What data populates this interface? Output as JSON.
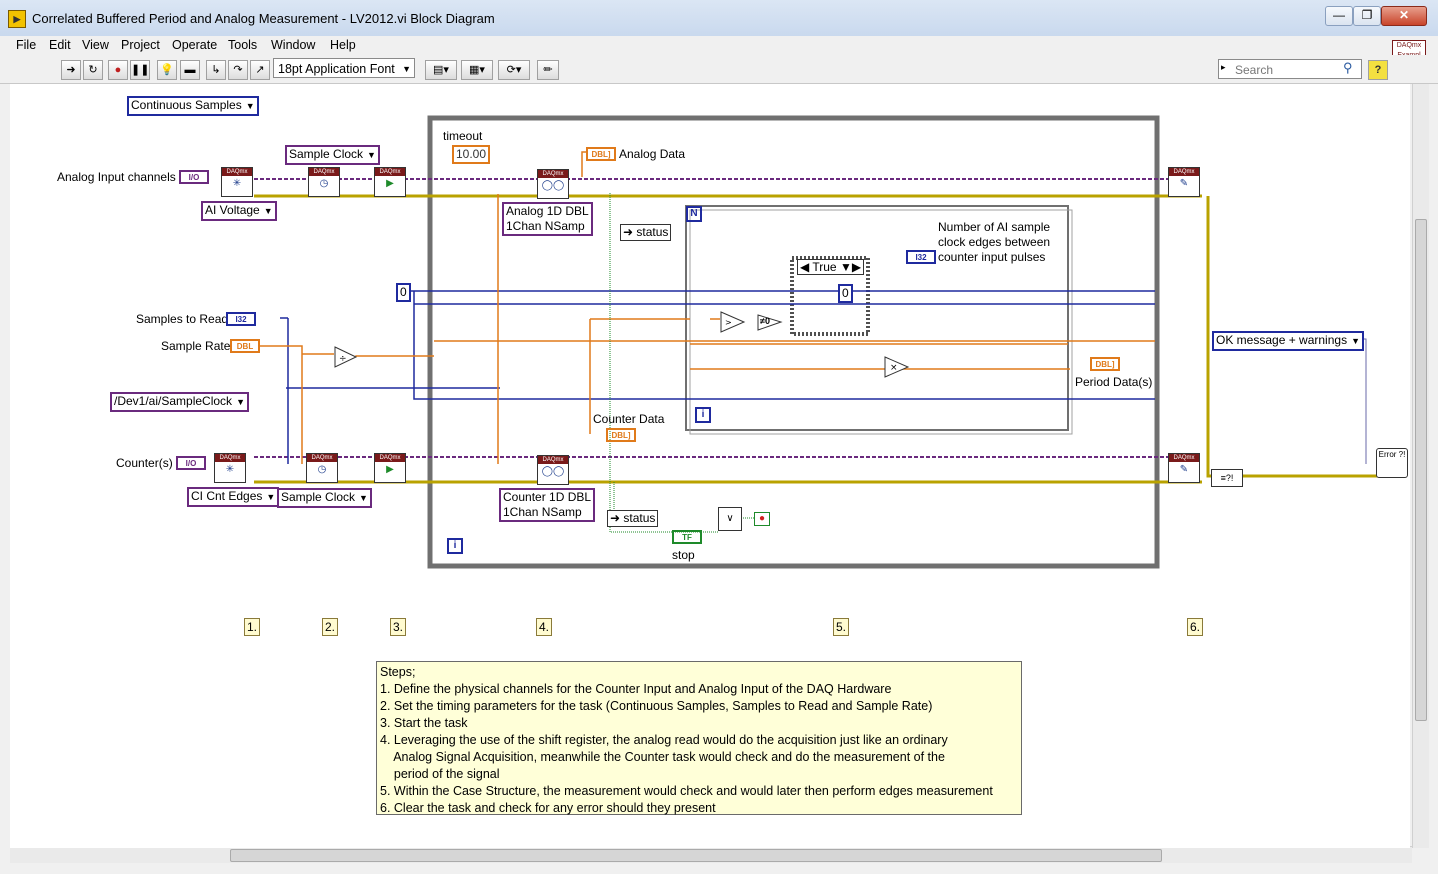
{
  "window": {
    "title": "Correlated Buffered Period and Analog Measurement - LV2012.vi Block Diagram",
    "controls": [
      "—",
      "❐",
      "✕"
    ]
  },
  "menu": [
    "File",
    "Edit",
    "View",
    "Project",
    "Operate",
    "Tools",
    "Window",
    "Help"
  ],
  "toolbar": {
    "font": "18pt Application Font",
    "search_placeholder": "Search",
    "help": "?",
    "example_badge": "DAQmx Exampl"
  },
  "labels": {
    "analog_input_channels": "Analog Input channels",
    "samples_to_read": "Samples to Read",
    "sample_rate": "Sample Rate",
    "counters": "Counter(s)",
    "timeout": "timeout",
    "analog_data": "Analog Data",
    "counter_data": "Counter Data",
    "period_data": "Period Data(s)",
    "stop": "stop",
    "num_ai_edges_1": "Number of AI sample",
    "num_ai_edges_2": "clock edges between",
    "num_ai_edges_3": "counter input pulses"
  },
  "controls": {
    "continuous_samples": "Continuous Samples",
    "sample_clock_top": "Sample Clock",
    "ai_voltage": "AI Voltage",
    "analog_1d_dbl_1": "Analog 1D DBL",
    "analog_1d_dbl_2": "1Chan NSamp",
    "counter_1d_dbl_1": "Counter 1D DBL",
    "counter_1d_dbl_2": "1Chan NSamp",
    "dev_sample_clock": "/Dev1/ai/SampleClock",
    "ci_cnt_edges": "CI Cnt Edges",
    "sample_clock_bottom": "Sample Clock",
    "ok_message": "OK message + warnings",
    "timeout_value": "10.00",
    "status_top": "status",
    "status_bottom": "status",
    "case_selector": "True",
    "zero_const_left": "0",
    "zero_const_case": "0",
    "not_equal_zero": "≠0"
  },
  "terminals": {
    "io": "I/O",
    "i32": "I32",
    "dbl": "DBL",
    "dbl_array": "DBL]",
    "tf": "TF",
    "loop_i": "i",
    "loop_n": "N",
    "error_icon": "Error ?!"
  },
  "daq": {
    "header": "DAQmx"
  },
  "steps": [
    "1.",
    "2.",
    "3.",
    "4.",
    "5.",
    "6."
  ],
  "notes": [
    "Steps;",
    "1. Define the physical channels for the Counter Input and Analog Input of the DAQ Hardware",
    "2. Set the timing parameters for the task (Continuous Samples, Samples to Read and Sample Rate)",
    "3. Start the task",
    "4. Leveraging the use of the shift register, the analog read would do the acquisition just like an ordinary",
    "    Analog Signal Acquisition, meanwhile the Counter task would check and do the measurement of the",
    "    period of the signal",
    "5. Within the Case Structure, the measurement would check and would later then perform edges measurement",
    "6. Clear the task and check for any error should they present"
  ],
  "colors": {
    "task_wire": "#6a2a7e",
    "error_wire": "#b9a200",
    "numeric_wire": "#1f2a9e",
    "dbl_wire": "#e07a1a",
    "bool_wire": "#1e8a2a",
    "loop_frame": "#707070"
  }
}
